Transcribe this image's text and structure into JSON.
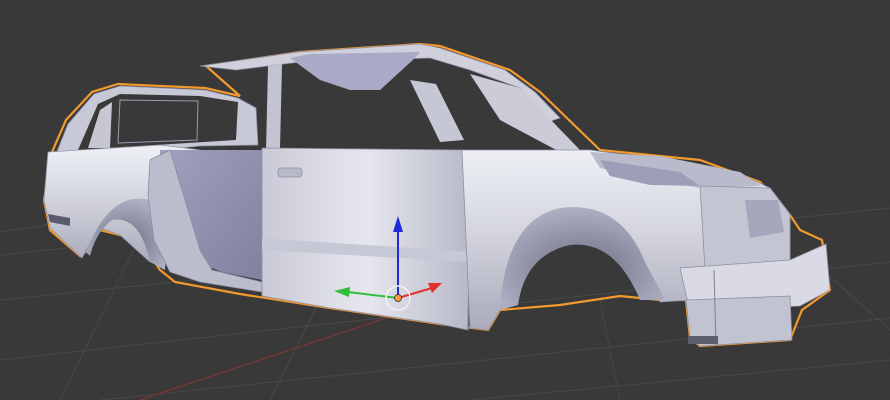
{
  "viewport": {
    "view": "3d-viewport",
    "background_color": "#393939",
    "grid_color": "#4a4a4a",
    "x_axis_color": "#8a3a3a",
    "selection_outline_color": "#f29a2e"
  },
  "object": {
    "name": "car-body-shell",
    "selected": true,
    "body_color": "#d6d6de",
    "shadow_color": "#9d9fb8"
  },
  "gizmo": {
    "x_axis_color": "#e0302c",
    "y_axis_color": "#2fbf3a",
    "z_axis_color": "#1f2ad8",
    "pivot_color": "#ff9a3a"
  }
}
